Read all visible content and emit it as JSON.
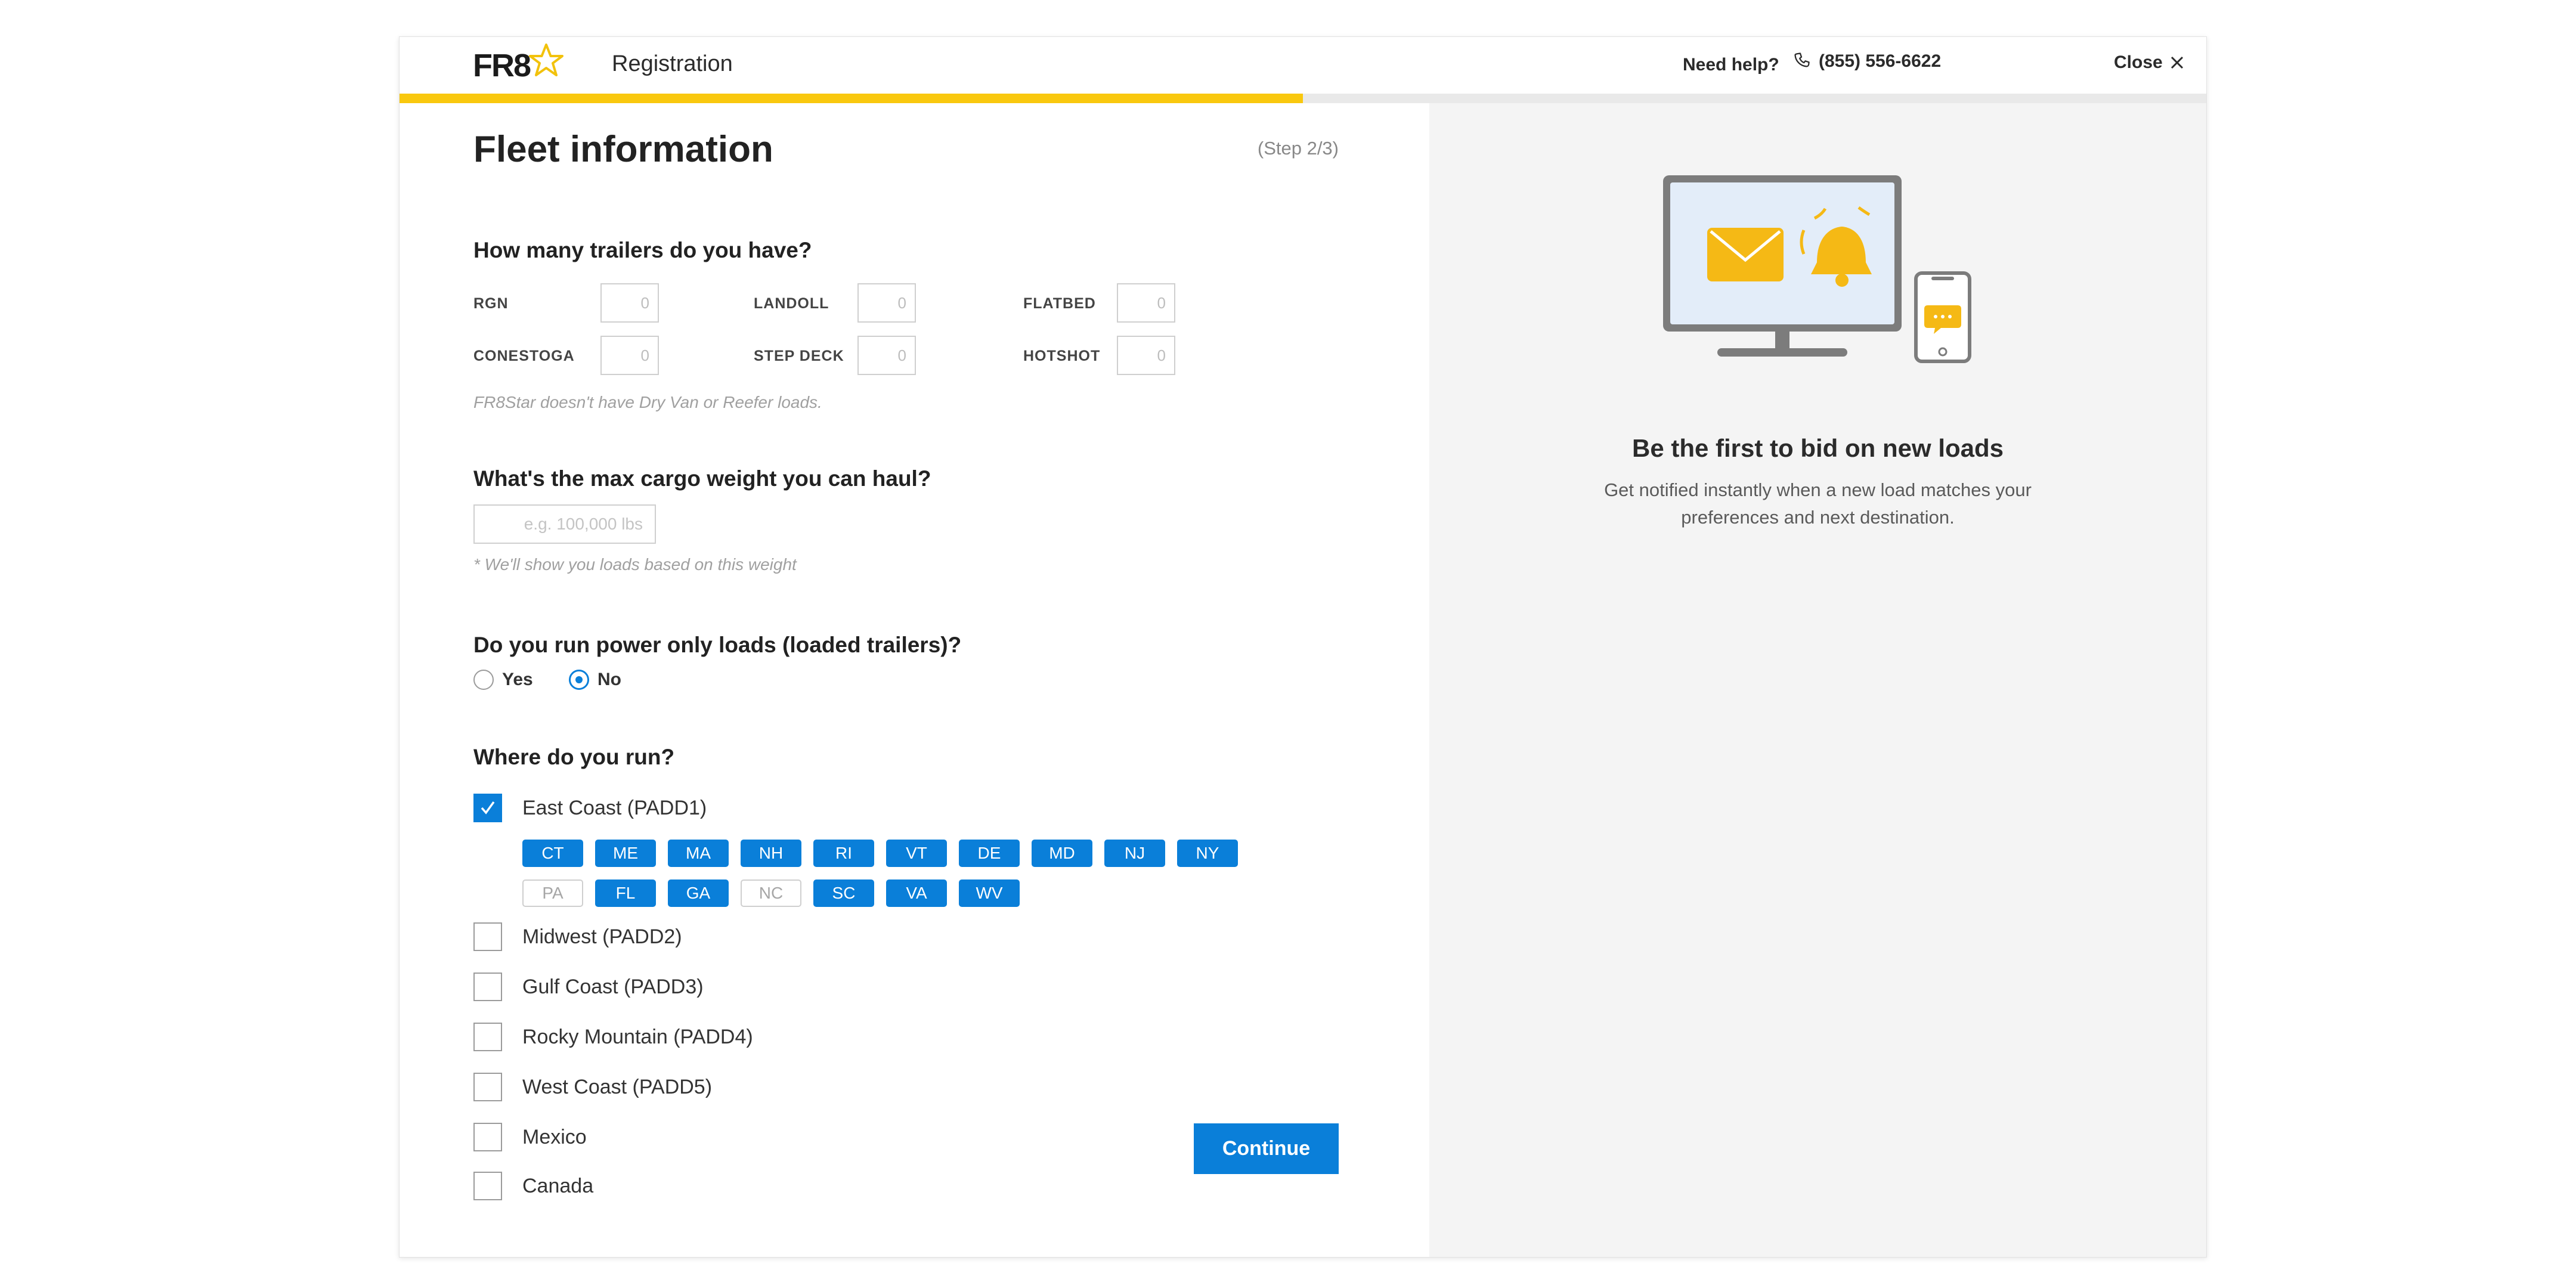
{
  "header": {
    "logo_text": "FR8",
    "title": "Registration",
    "help_label": "Need help?",
    "phone": "(855) 556-6622",
    "close_label": "Close",
    "progress_fraction": 0.5
  },
  "form": {
    "title": "Fleet information",
    "step": "(Step 2/3)",
    "trailers": {
      "question": "How many trailers do you have?",
      "items": [
        {
          "label": "RGN",
          "placeholder": "0"
        },
        {
          "label": "LANDOLL",
          "placeholder": "0"
        },
        {
          "label": "FLATBED",
          "placeholder": "0"
        },
        {
          "label": "CONESTOGA",
          "placeholder": "0"
        },
        {
          "label": "STEP DECK",
          "placeholder": "0"
        },
        {
          "label": "HOTSHOT",
          "placeholder": "0"
        }
      ],
      "note": "FR8Star doesn't have Dry Van or Reefer loads."
    },
    "weight": {
      "question": "What's the max cargo weight you can haul?",
      "placeholder": "e.g. 100,000 lbs",
      "note": "* We'll show you loads based on this weight"
    },
    "power_only": {
      "question": "Do you run power only loads (loaded trailers)?",
      "options": [
        {
          "label": "Yes",
          "selected": false
        },
        {
          "label": "No",
          "selected": true
        }
      ]
    },
    "regions": {
      "question": "Where do you run?",
      "items": [
        {
          "label": "East Coast (PADD1)",
          "checked": true
        },
        {
          "label": "Midwest (PADD2)",
          "checked": false
        },
        {
          "label": "Gulf Coast (PADD3)",
          "checked": false
        },
        {
          "label": "Rocky Mountain (PADD4)",
          "checked": false
        },
        {
          "label": "West Coast (PADD5)",
          "checked": false
        },
        {
          "label": "Mexico",
          "checked": false
        },
        {
          "label": "Canada",
          "checked": false
        }
      ],
      "states_row1": [
        {
          "code": "CT",
          "selected": true
        },
        {
          "code": "ME",
          "selected": true
        },
        {
          "code": "MA",
          "selected": true
        },
        {
          "code": "NH",
          "selected": true
        },
        {
          "code": "RI",
          "selected": true
        },
        {
          "code": "VT",
          "selected": true
        },
        {
          "code": "DE",
          "selected": true
        },
        {
          "code": "MD",
          "selected": true
        },
        {
          "code": "NJ",
          "selected": true
        },
        {
          "code": "NY",
          "selected": true
        }
      ],
      "states_row2": [
        {
          "code": "PA",
          "selected": false
        },
        {
          "code": "FL",
          "selected": true
        },
        {
          "code": "GA",
          "selected": true
        },
        {
          "code": "NC",
          "selected": false
        },
        {
          "code": "SC",
          "selected": true
        },
        {
          "code": "VA",
          "selected": true
        },
        {
          "code": "WV",
          "selected": true
        }
      ]
    },
    "continue_label": "Continue"
  },
  "promo": {
    "title": "Be the first to bid on new loads",
    "text": "Get notified instantly when a new load matches your preferences and next destination.",
    "illustration_icons": [
      "monitor-icon",
      "envelope-icon",
      "bell-icon",
      "phone-icon",
      "chat-bubble-icon"
    ]
  },
  "colors": {
    "accent": "#0a7fd9",
    "brand_yellow": "#f9c80e",
    "panel_bg": "#f4f4f4"
  }
}
